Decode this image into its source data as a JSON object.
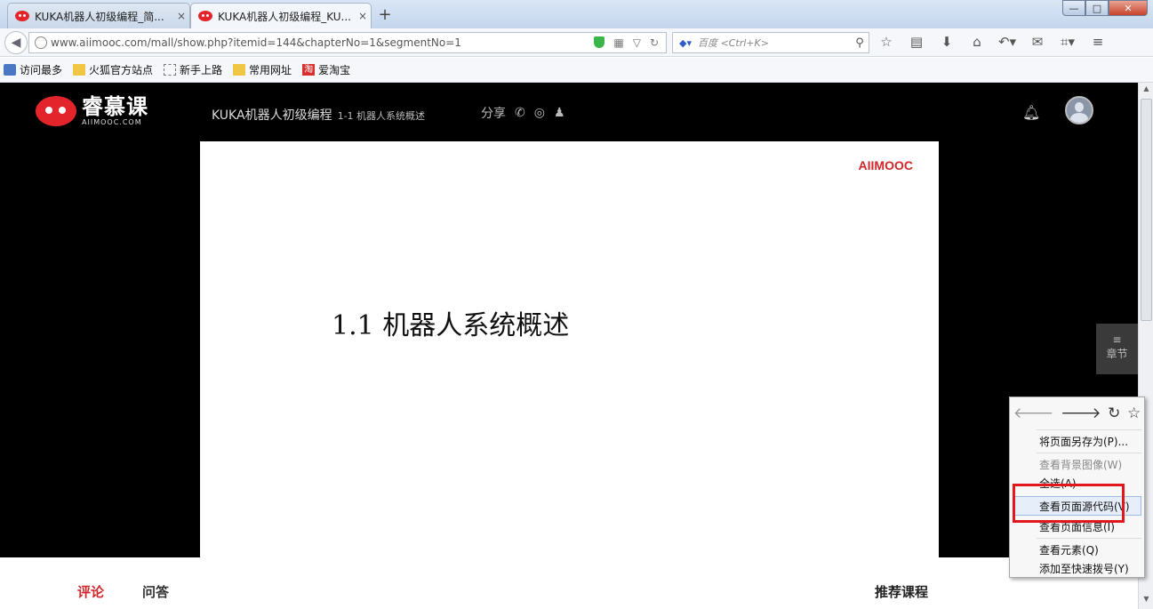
{
  "tabs": [
    {
      "title": "KUKA机器人初级编程_简...",
      "close": "×"
    },
    {
      "title": "KUKA机器人初级编程_KU...",
      "close": "×"
    }
  ],
  "new_tab": "+",
  "window_buttons": {
    "minimize": "—",
    "maximize": "□",
    "close": "✕"
  },
  "address": {
    "url": "www.aiimooc.com/mall/show.php?itemid=144&chapterNo=1&segmentNo=1"
  },
  "search": {
    "engine_icon": "baidu-paw-icon",
    "placeholder": "百度 <Ctrl+K>"
  },
  "toolbar_icons": [
    "bookmark-star-icon",
    "reading-list-icon",
    "download-icon",
    "home-icon",
    "undo-icon",
    "chat-icon",
    "crop-icon",
    "menu-icon"
  ],
  "bookmarks": [
    {
      "label": "访问最多",
      "icon": "most-visited-icon"
    },
    {
      "label": "火狐官方站点",
      "icon": "folder-icon"
    },
    {
      "label": "新手上路",
      "icon": "dashed-page-icon"
    },
    {
      "label": "常用网址",
      "icon": "folder-icon"
    },
    {
      "label": "爱淘宝",
      "icon": "taobao-icon",
      "icon_text": "淘"
    }
  ],
  "site": {
    "logo_cn": "睿慕课",
    "logo_en": "AIIMOOC.COM",
    "course_title": "KUKA机器人初级编程",
    "segment": "1-1 机器人系统概述",
    "share_label": "分享",
    "brand_color": "#d0262a"
  },
  "slide": {
    "brand": "AIIMOOC",
    "title": "1.1  机器人系统概述"
  },
  "chapter_button": {
    "icon": "≡",
    "label": "章节"
  },
  "bottom_nav": {
    "comment": "评论",
    "qa": "问答",
    "recommended": "推荐课程"
  },
  "context_menu": {
    "nav": [
      "back-arrow-icon",
      "forward-arrow-icon",
      "reload-icon",
      "bookmark-star-icon"
    ],
    "items": [
      {
        "label": "将页面另存为(P)...",
        "enabled": true
      },
      {
        "label": "查看背景图像(W)",
        "enabled": false
      },
      {
        "label": "全选(A)",
        "enabled": true
      },
      {
        "label": "查看页面源代码(V)",
        "enabled": true,
        "highlighted": true
      },
      {
        "label": "查看页面信息(I)",
        "enabled": true
      },
      {
        "label": "查看元素(Q)",
        "enabled": true
      },
      {
        "label": "添加至快速拨号(Y)",
        "enabled": true
      }
    ]
  },
  "annotation_color": "#e3161e"
}
